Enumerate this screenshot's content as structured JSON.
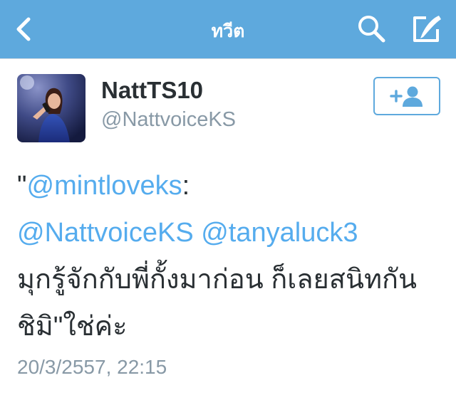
{
  "navbar": {
    "title": "ทวีต",
    "background": "#5ea9dd",
    "back_icon": "chevron-left-icon",
    "search_icon": "search-icon",
    "compose_icon": "compose-icon"
  },
  "tweet": {
    "display_name": "NattTS10",
    "handle": "@NattvoiceKS",
    "follow_icon": "add-user-icon",
    "text": {
      "quote_open": "\"",
      "mention_1": "@mintloveks",
      "colon": ":",
      "mention_2": "@NattvoiceKS",
      "mention_3": "@tanyaluck3",
      "line_3": "มุกรู้จักกับพี่กั้งมาก่อน ก็เลยสนิทกัน",
      "line_4": "ชิมิ\"ใช่ค่ะ"
    },
    "timestamp": "20/3/2557, 22:15"
  },
  "colors": {
    "accent": "#5ea9dd",
    "link": "#55acee",
    "text": "#292f33",
    "muted": "#8899a6"
  }
}
